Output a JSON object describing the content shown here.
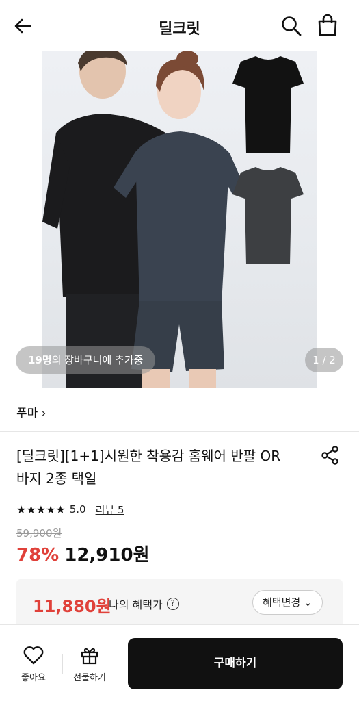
{
  "header": {
    "title": "딜크릿",
    "back_icon": "arrow-left-icon",
    "search_icon": "search-icon",
    "cart_icon": "shopping-bag-icon"
  },
  "hero": {
    "cart_count": "19명",
    "cart_text": "의 장바구니에 추가중",
    "pager": "1 / 2"
  },
  "brand": {
    "label": "푸마 ›"
  },
  "product": {
    "title": "[딜크릿][1+1]시원한 착용감 홈웨어 반팔 OR 바지 2종 택일",
    "stars": "★★★★★",
    "score": "5.0",
    "reviews": "리뷰 5",
    "original_price": "59,900원",
    "discount": "78%",
    "price": "12,910원"
  },
  "benefit": {
    "price": "11,880원",
    "label": "나의 혜택가",
    "help": "?",
    "change": "혜택변경 ⌄"
  },
  "bottom": {
    "like_label": "좋아요",
    "gift_label": "선물하기",
    "buy_label": "구매하기"
  },
  "colors": {
    "accent_red": "#e0413a",
    "buy_button": "#111111"
  }
}
